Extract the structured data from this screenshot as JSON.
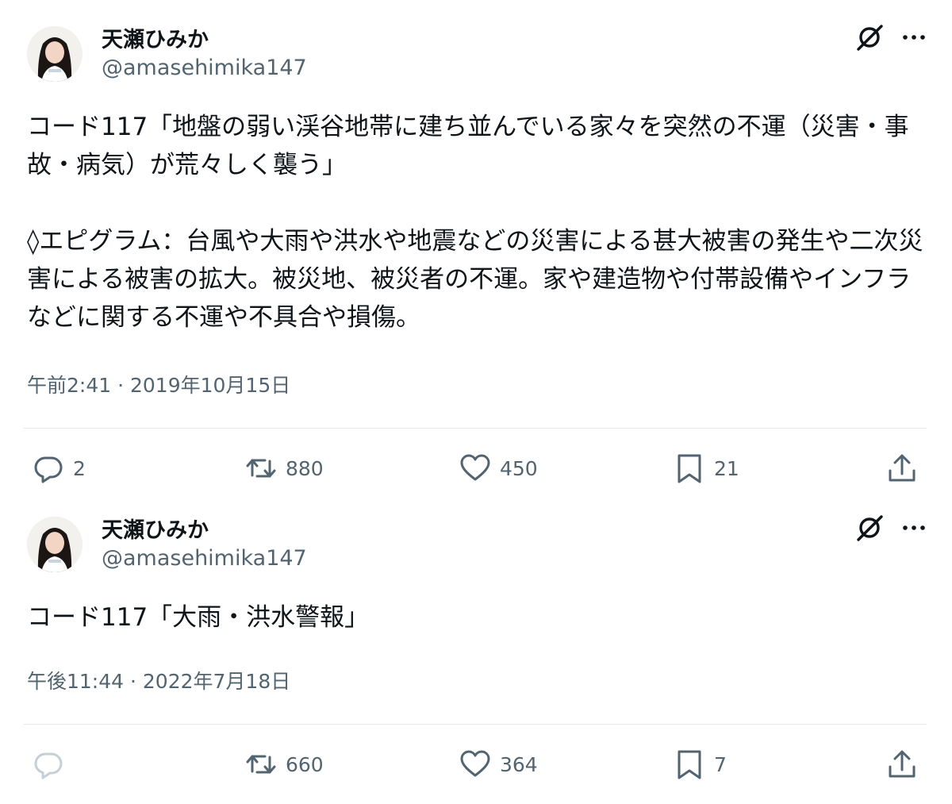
{
  "tweets": [
    {
      "author": {
        "name": "天瀬ひみか",
        "handle": "@amasehimika147"
      },
      "text": "コード117「地盤の弱い渓谷地帯に建ち並んでいる家々を突然の不運（災害・事故・病気）が荒々しく襲う」\n\n◊エピグラム：台風や大雨や洪水や地震などの災害による甚大被害の発生や二次災害による被害の拡大。被災地、被災者の不運。家や建造物や付帯設備やインフラなどに関する不運や不具合や損傷。",
      "timestamp": "午前2:41 · 2019年10月15日",
      "metrics": {
        "replies": "2",
        "reposts": "880",
        "likes": "450",
        "bookmarks": "21"
      }
    },
    {
      "author": {
        "name": "天瀬ひみか",
        "handle": "@amasehimika147"
      },
      "text": "コード117「大雨・洪水警報」",
      "timestamp": "午後11:44 · 2022年7月18日",
      "metrics": {
        "replies": "",
        "reposts": "660",
        "likes": "364",
        "bookmarks": "7"
      }
    }
  ],
  "icons": {
    "grok": "grok-icon",
    "more": "more-icon",
    "reply": "reply-icon",
    "repost": "repost-icon",
    "like": "heart-icon",
    "bookmark": "bookmark-icon",
    "share": "share-icon"
  },
  "colors": {
    "text": "#0f1419",
    "secondary": "#536471",
    "divider": "#e4e8eb",
    "reply_disabled": "#c4cfd6"
  }
}
